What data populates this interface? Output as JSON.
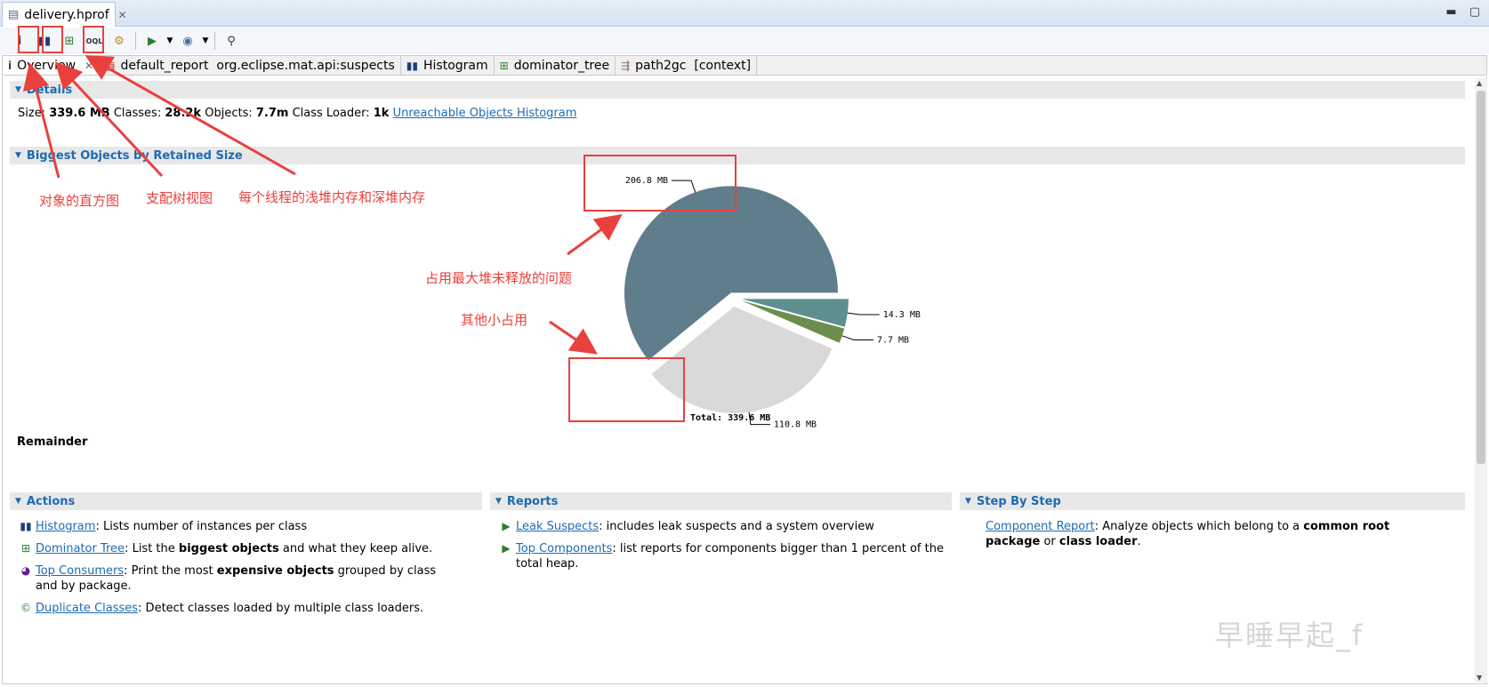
{
  "editor_tab": {
    "title": "delivery.hprof"
  },
  "view_tabs": [
    {
      "label": "Overview",
      "icon": "info-icon"
    },
    {
      "label": "default_report  org.eclipse.mat.api:suspects",
      "icon": "report-icon"
    },
    {
      "label": "Histogram",
      "icon": "histogram-icon"
    },
    {
      "label": "dominator_tree",
      "icon": "tree-icon"
    },
    {
      "label": "path2gc  [context]",
      "icon": "path-icon"
    }
  ],
  "details": {
    "heading": "Details",
    "size_label": "Size:",
    "size_value": "339.6 MB",
    "classes_label": "Classes:",
    "classes_value": "28.2k",
    "objects_label": "Objects:",
    "objects_value": "7.7m",
    "classloader_label": "Class Loader:",
    "classloader_value": "1k",
    "link": "Unreachable Objects Histogram"
  },
  "biggest": {
    "heading": "Biggest Objects by Retained Size"
  },
  "chart_data": {
    "type": "pie",
    "total_label": "Total: 339.6 MB",
    "slices": [
      {
        "label": "206.8 MB",
        "value": 206.8,
        "color": "#607d8b"
      },
      {
        "label": "110.8 MB",
        "value": 110.8,
        "color": "#d9d9d9"
      },
      {
        "label": "7.7 MB",
        "value": 7.7,
        "color": "#6b8e4e"
      },
      {
        "label": "14.3 MB",
        "value": 14.3,
        "color": "#5e8f8f"
      }
    ]
  },
  "remainder": "Remainder",
  "actions": {
    "heading": "Actions",
    "items": [
      {
        "link": "Histogram",
        "text": ": Lists number of instances per class"
      },
      {
        "link": "Dominator Tree",
        "text_before": ": List the ",
        "bold": "biggest objects",
        "text_after": " and what they keep alive."
      },
      {
        "link": "Top Consumers",
        "text_before": ": Print the most ",
        "bold": "expensive objects",
        "text_after": " grouped by class and by package."
      },
      {
        "link": "Duplicate Classes",
        "text": ": Detect classes loaded by multiple class loaders."
      }
    ]
  },
  "reports": {
    "heading": "Reports",
    "items": [
      {
        "link": "Leak Suspects",
        "text": ": includes leak suspects and a system overview"
      },
      {
        "link": "Top Components",
        "text": ": list reports for components bigger than 1 percent of the total heap."
      }
    ]
  },
  "step_by_step": {
    "heading": "Step By Step",
    "link": "Component Report",
    "text_before": ": Analyze objects which belong to a ",
    "bold1": "common root package",
    "text_mid": " or ",
    "bold2": "class loader",
    "text_after": "."
  },
  "annotations": {
    "histogram": "对象的直方图",
    "dominator": "支配树视图",
    "threads": "每个线程的浅堆内存和深堆内存",
    "largest": "占用最大堆未释放的问题",
    "others": "其他小占用"
  },
  "watermark": "早睡早起_f",
  "colors": {
    "accent": "#1c6bb3",
    "annotation": "#e8413d"
  }
}
